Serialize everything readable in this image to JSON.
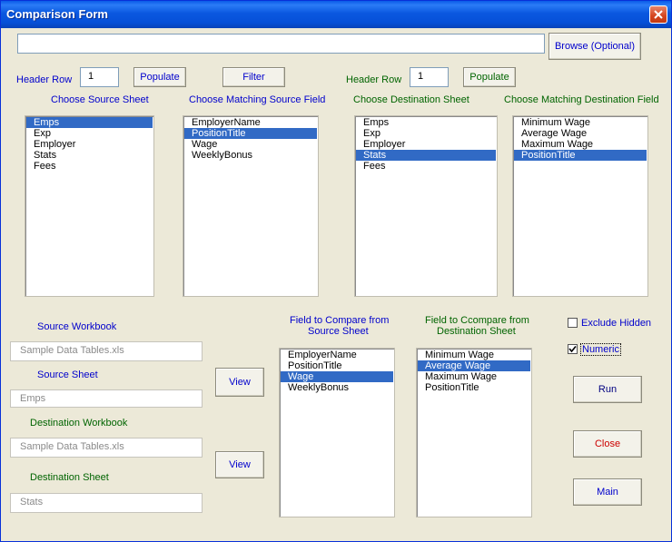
{
  "window": {
    "title": "Comparison Form"
  },
  "path_input": {
    "value": ""
  },
  "browse_label": "Browse (Optional)",
  "source": {
    "header_row_label": "Header Row",
    "header_row_value": "1",
    "populate_label": "Populate",
    "sheet_heading": "Choose Source Sheet",
    "sheets": [
      "Emps",
      "Exp",
      "Employer",
      "Stats",
      "Fees"
    ],
    "field_heading": "Choose Matching Source Field",
    "fields": [
      "EmployerName",
      "PositionTitle",
      "Wage",
      "WeeklyBonus"
    ]
  },
  "filter_label": "Filter",
  "destination": {
    "header_row_label": "Header Row",
    "header_row_value": "1",
    "populate_label": "Populate",
    "sheet_heading": "Choose Destination Sheet",
    "sheets": [
      "Emps",
      "Exp",
      "Employer",
      "Stats",
      "Fees"
    ],
    "field_heading": "Choose Matching Destination Field",
    "fields": [
      "Minimum Wage",
      "Average Wage",
      "Maximum Wage",
      "PositionTitle"
    ]
  },
  "info": {
    "source_workbook_label": "Source Workbook",
    "source_workbook_value": "Sample Data Tables.xls",
    "source_sheet_label": "Source Sheet",
    "source_sheet_value": "Emps",
    "dest_workbook_label": "Destination Workbook",
    "dest_workbook_value": "Sample Data Tables.xls",
    "dest_sheet_label": "Destination Sheet",
    "dest_sheet_value": "Stats"
  },
  "view_label_1": "View",
  "view_label_2": "View",
  "compare_source": {
    "heading_line1": "Field to Compare from",
    "heading_line2": "Source Sheet",
    "fields": [
      "EmployerName",
      "PositionTitle",
      "Wage",
      "WeeklyBonus"
    ]
  },
  "compare_dest": {
    "heading_line1": "Field to Ccompare from",
    "heading_line2": "Destination Sheet",
    "fields": [
      "Minimum Wage",
      "Average Wage",
      "Maximum Wage",
      "PositionTitle"
    ]
  },
  "options": {
    "exclude_hidden_label": "Exclude Hidden",
    "exclude_hidden_checked": false,
    "numeric_label": "Numeric",
    "numeric_checked": true
  },
  "run_label": "Run",
  "close_label": "Close",
  "main_label": "Main",
  "colors": {
    "selection": "#316ac5",
    "blue_text": "#0000cc",
    "green_text": "#006400",
    "close_text": "#cc0000"
  }
}
